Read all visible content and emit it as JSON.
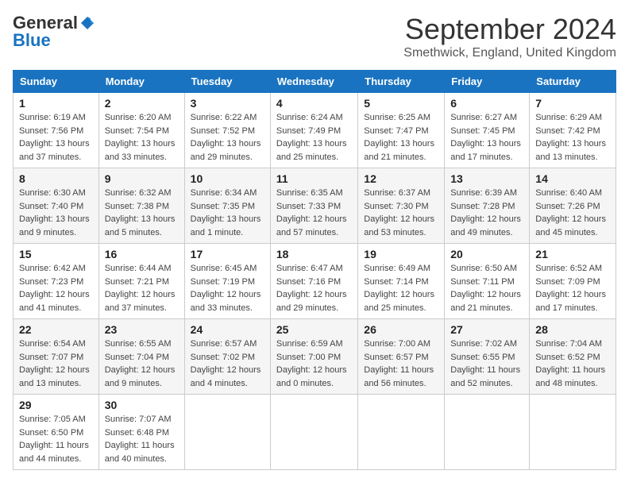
{
  "logo": {
    "line1": "General",
    "line2": "Blue"
  },
  "title": "September 2024",
  "location": "Smethwick, England, United Kingdom",
  "days_of_week": [
    "Sunday",
    "Monday",
    "Tuesday",
    "Wednesday",
    "Thursday",
    "Friday",
    "Saturday"
  ],
  "weeks": [
    [
      {
        "day": "1",
        "sunrise": "Sunrise: 6:19 AM",
        "sunset": "Sunset: 7:56 PM",
        "daylight": "Daylight: 13 hours and 37 minutes."
      },
      {
        "day": "2",
        "sunrise": "Sunrise: 6:20 AM",
        "sunset": "Sunset: 7:54 PM",
        "daylight": "Daylight: 13 hours and 33 minutes."
      },
      {
        "day": "3",
        "sunrise": "Sunrise: 6:22 AM",
        "sunset": "Sunset: 7:52 PM",
        "daylight": "Daylight: 13 hours and 29 minutes."
      },
      {
        "day": "4",
        "sunrise": "Sunrise: 6:24 AM",
        "sunset": "Sunset: 7:49 PM",
        "daylight": "Daylight: 13 hours and 25 minutes."
      },
      {
        "day": "5",
        "sunrise": "Sunrise: 6:25 AM",
        "sunset": "Sunset: 7:47 PM",
        "daylight": "Daylight: 13 hours and 21 minutes."
      },
      {
        "day": "6",
        "sunrise": "Sunrise: 6:27 AM",
        "sunset": "Sunset: 7:45 PM",
        "daylight": "Daylight: 13 hours and 17 minutes."
      },
      {
        "day": "7",
        "sunrise": "Sunrise: 6:29 AM",
        "sunset": "Sunset: 7:42 PM",
        "daylight": "Daylight: 13 hours and 13 minutes."
      }
    ],
    [
      {
        "day": "8",
        "sunrise": "Sunrise: 6:30 AM",
        "sunset": "Sunset: 7:40 PM",
        "daylight": "Daylight: 13 hours and 9 minutes."
      },
      {
        "day": "9",
        "sunrise": "Sunrise: 6:32 AM",
        "sunset": "Sunset: 7:38 PM",
        "daylight": "Daylight: 13 hours and 5 minutes."
      },
      {
        "day": "10",
        "sunrise": "Sunrise: 6:34 AM",
        "sunset": "Sunset: 7:35 PM",
        "daylight": "Daylight: 13 hours and 1 minute."
      },
      {
        "day": "11",
        "sunrise": "Sunrise: 6:35 AM",
        "sunset": "Sunset: 7:33 PM",
        "daylight": "Daylight: 12 hours and 57 minutes."
      },
      {
        "day": "12",
        "sunrise": "Sunrise: 6:37 AM",
        "sunset": "Sunset: 7:30 PM",
        "daylight": "Daylight: 12 hours and 53 minutes."
      },
      {
        "day": "13",
        "sunrise": "Sunrise: 6:39 AM",
        "sunset": "Sunset: 7:28 PM",
        "daylight": "Daylight: 12 hours and 49 minutes."
      },
      {
        "day": "14",
        "sunrise": "Sunrise: 6:40 AM",
        "sunset": "Sunset: 7:26 PM",
        "daylight": "Daylight: 12 hours and 45 minutes."
      }
    ],
    [
      {
        "day": "15",
        "sunrise": "Sunrise: 6:42 AM",
        "sunset": "Sunset: 7:23 PM",
        "daylight": "Daylight: 12 hours and 41 minutes."
      },
      {
        "day": "16",
        "sunrise": "Sunrise: 6:44 AM",
        "sunset": "Sunset: 7:21 PM",
        "daylight": "Daylight: 12 hours and 37 minutes."
      },
      {
        "day": "17",
        "sunrise": "Sunrise: 6:45 AM",
        "sunset": "Sunset: 7:19 PM",
        "daylight": "Daylight: 12 hours and 33 minutes."
      },
      {
        "day": "18",
        "sunrise": "Sunrise: 6:47 AM",
        "sunset": "Sunset: 7:16 PM",
        "daylight": "Daylight: 12 hours and 29 minutes."
      },
      {
        "day": "19",
        "sunrise": "Sunrise: 6:49 AM",
        "sunset": "Sunset: 7:14 PM",
        "daylight": "Daylight: 12 hours and 25 minutes."
      },
      {
        "day": "20",
        "sunrise": "Sunrise: 6:50 AM",
        "sunset": "Sunset: 7:11 PM",
        "daylight": "Daylight: 12 hours and 21 minutes."
      },
      {
        "day": "21",
        "sunrise": "Sunrise: 6:52 AM",
        "sunset": "Sunset: 7:09 PM",
        "daylight": "Daylight: 12 hours and 17 minutes."
      }
    ],
    [
      {
        "day": "22",
        "sunrise": "Sunrise: 6:54 AM",
        "sunset": "Sunset: 7:07 PM",
        "daylight": "Daylight: 12 hours and 13 minutes."
      },
      {
        "day": "23",
        "sunrise": "Sunrise: 6:55 AM",
        "sunset": "Sunset: 7:04 PM",
        "daylight": "Daylight: 12 hours and 9 minutes."
      },
      {
        "day": "24",
        "sunrise": "Sunrise: 6:57 AM",
        "sunset": "Sunset: 7:02 PM",
        "daylight": "Daylight: 12 hours and 4 minutes."
      },
      {
        "day": "25",
        "sunrise": "Sunrise: 6:59 AM",
        "sunset": "Sunset: 7:00 PM",
        "daylight": "Daylight: 12 hours and 0 minutes."
      },
      {
        "day": "26",
        "sunrise": "Sunrise: 7:00 AM",
        "sunset": "Sunset: 6:57 PM",
        "daylight": "Daylight: 11 hours and 56 minutes."
      },
      {
        "day": "27",
        "sunrise": "Sunrise: 7:02 AM",
        "sunset": "Sunset: 6:55 PM",
        "daylight": "Daylight: 11 hours and 52 minutes."
      },
      {
        "day": "28",
        "sunrise": "Sunrise: 7:04 AM",
        "sunset": "Sunset: 6:52 PM",
        "daylight": "Daylight: 11 hours and 48 minutes."
      }
    ],
    [
      {
        "day": "29",
        "sunrise": "Sunrise: 7:05 AM",
        "sunset": "Sunset: 6:50 PM",
        "daylight": "Daylight: 11 hours and 44 minutes."
      },
      {
        "day": "30",
        "sunrise": "Sunrise: 7:07 AM",
        "sunset": "Sunset: 6:48 PM",
        "daylight": "Daylight: 11 hours and 40 minutes."
      },
      null,
      null,
      null,
      null,
      null
    ]
  ]
}
